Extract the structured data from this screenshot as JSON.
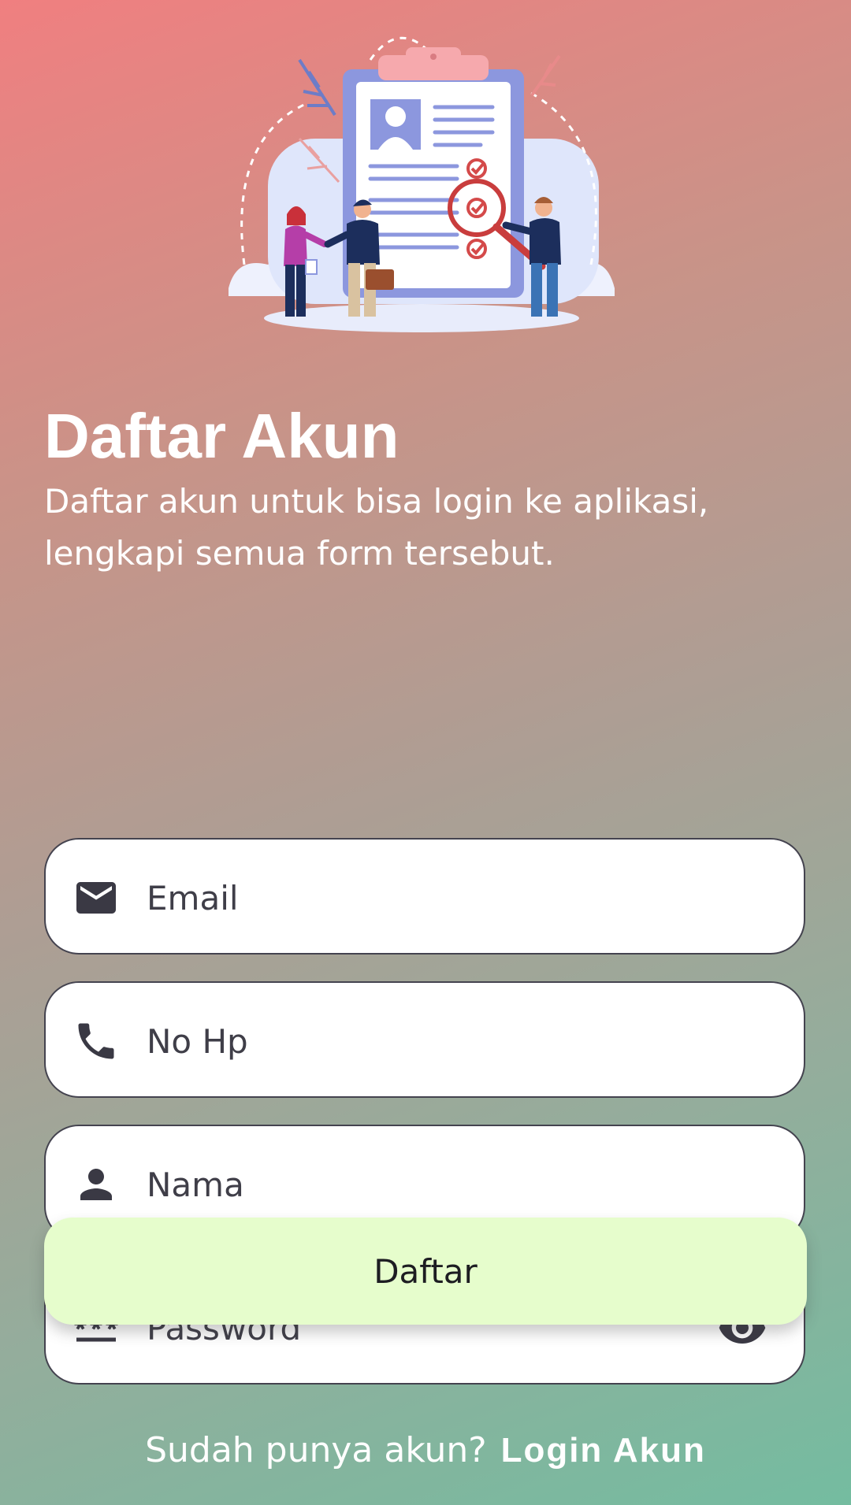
{
  "header": {
    "title": "Daftar Akun",
    "subtitle": "Daftar akun untuk bisa login ke aplikasi, lengkapi semua form tersebut."
  },
  "form": {
    "email": {
      "placeholder": "Email",
      "value": "",
      "icon": "email-icon"
    },
    "phone": {
      "placeholder": "No Hp",
      "value": "",
      "icon": "phone-icon"
    },
    "name": {
      "placeholder": "Nama",
      "value": "",
      "icon": "person-icon"
    },
    "password": {
      "placeholder": "Password",
      "value": "",
      "icon": "password-icon",
      "toggle_icon": "eye-icon"
    }
  },
  "actions": {
    "submit_label": "Daftar"
  },
  "footer": {
    "prompt": "Sudah punya akun?",
    "login_link": "Login Akun"
  },
  "colors": {
    "gradient_top": "#f07f80",
    "gradient_bottom": "#74bca0",
    "button_bg": "#e6fdcc",
    "field_border": "#44434f",
    "icon": "#3a3944"
  }
}
